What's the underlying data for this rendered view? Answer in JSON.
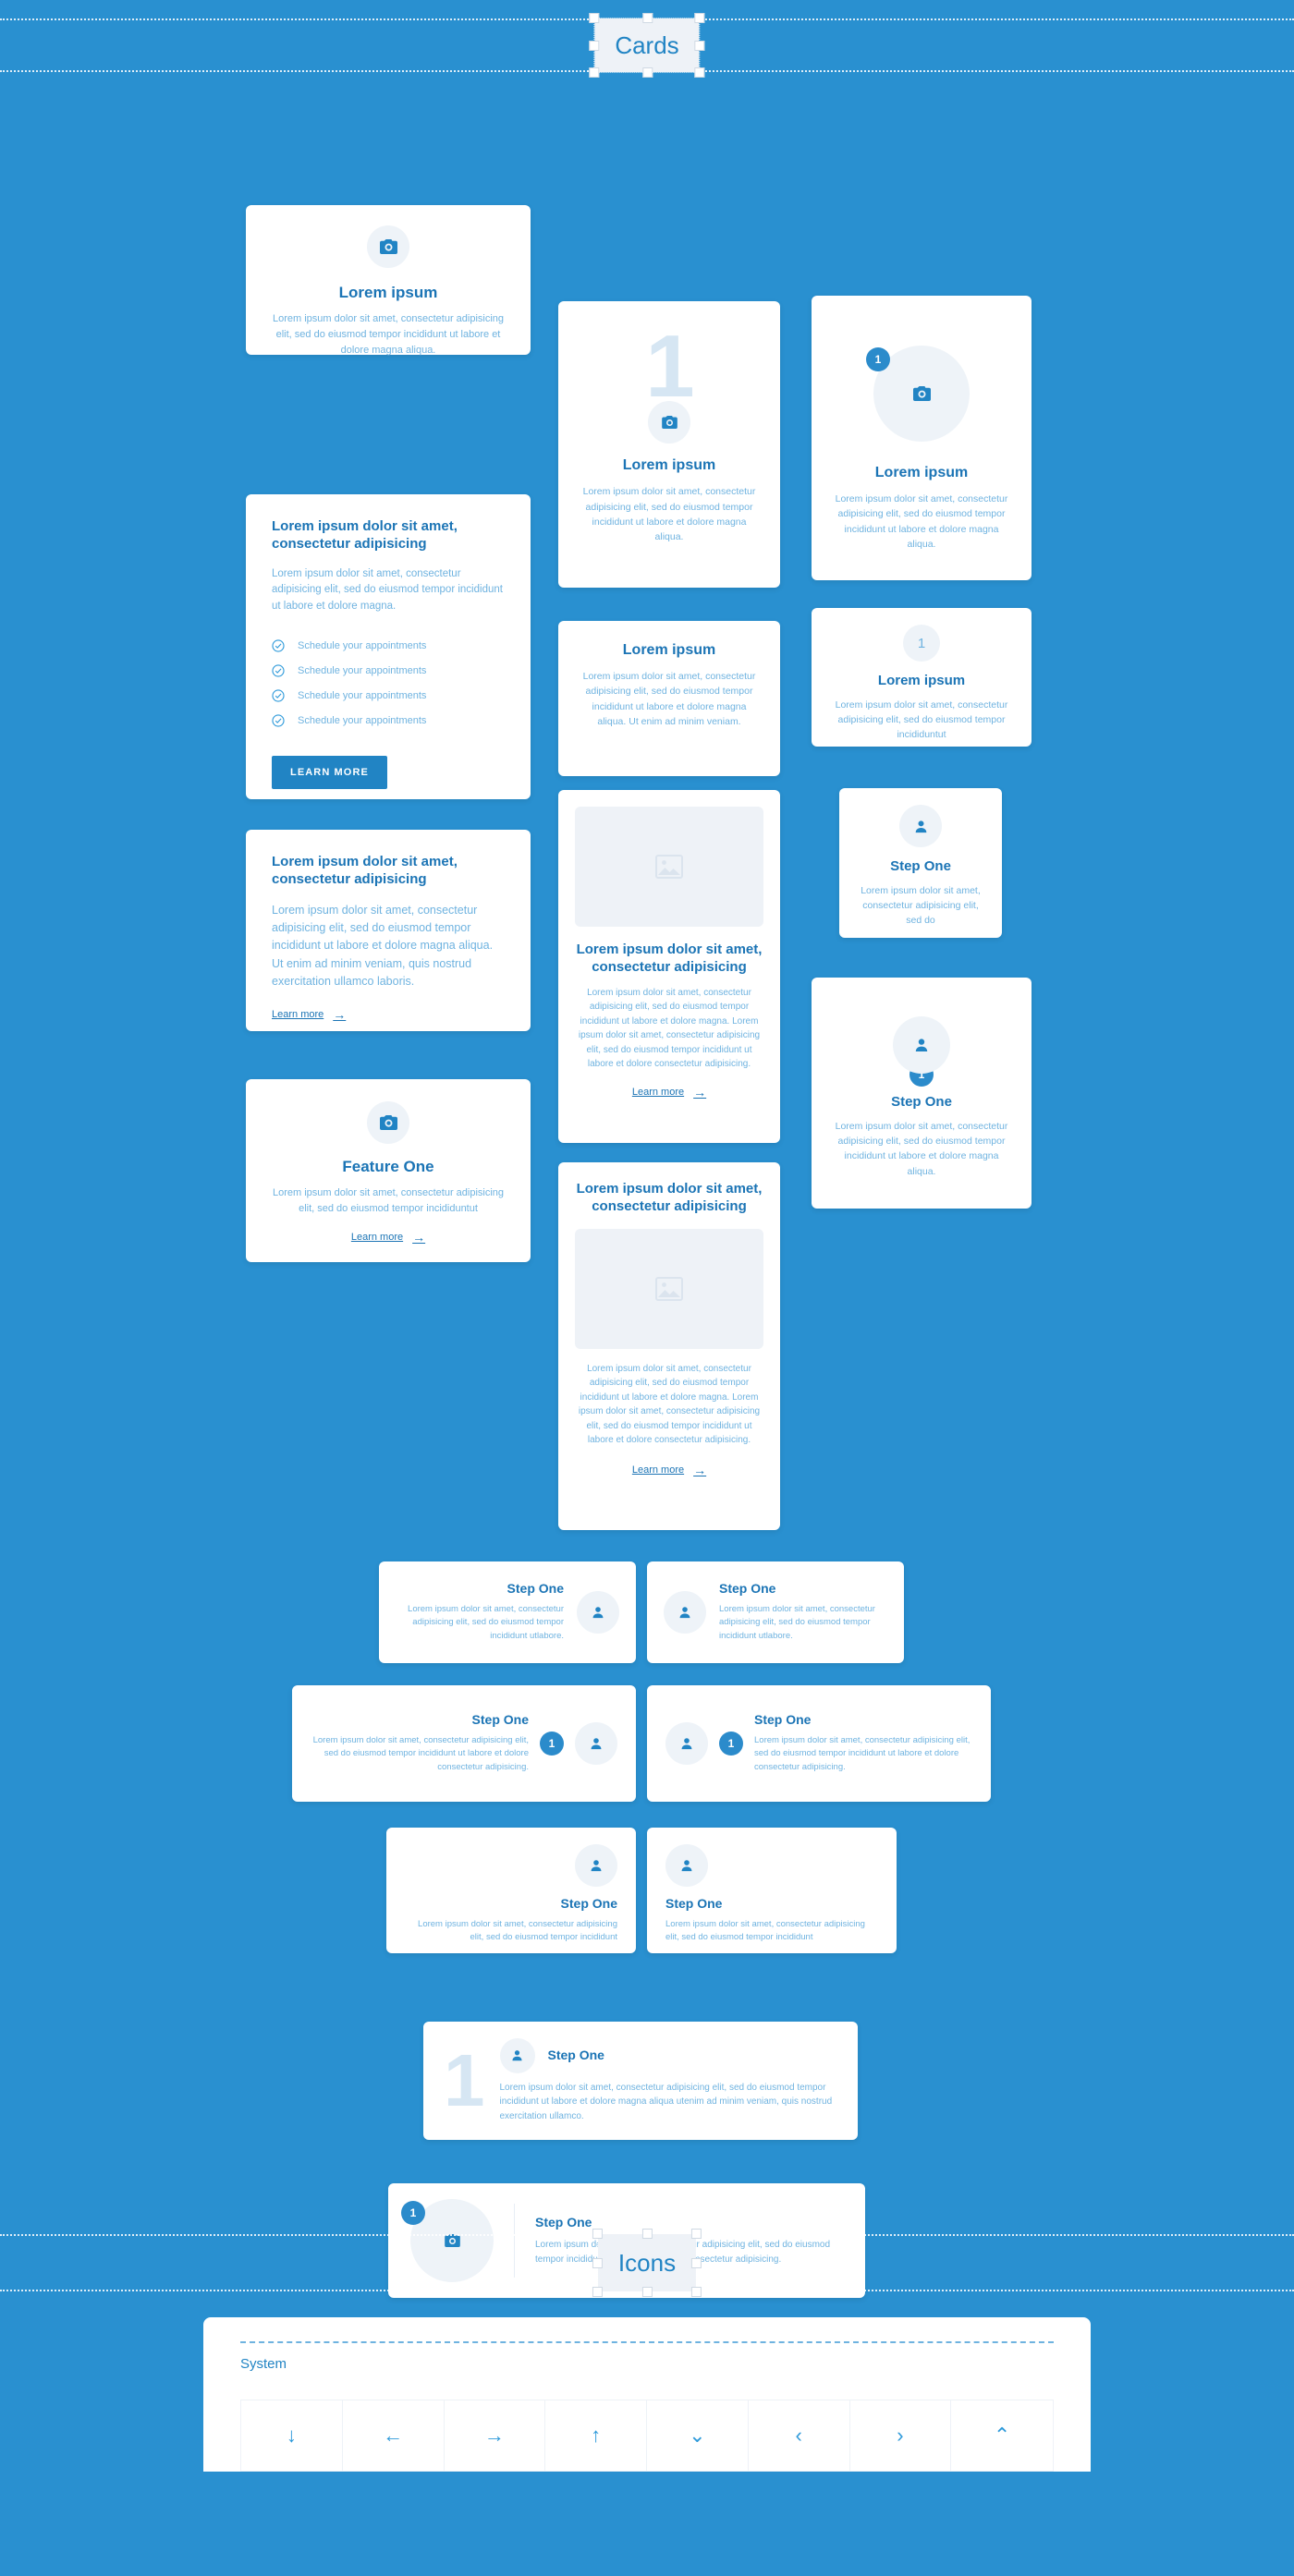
{
  "theme": {
    "background": "#2990d0",
    "card_bg": "#ffffff",
    "heading_color": "#1b74b5",
    "body_color": "#6fb3e0",
    "accent": "#2184c4",
    "icon_circle_bg": "#eef3f8",
    "ghost_number_color": "#d6e6f3"
  },
  "sections": {
    "cards_label": "Cards",
    "icons_label": "Icons"
  },
  "text": {
    "lorem_ipsum": "Lorem ipsum",
    "title_long": "Lorem ipsum dolor sit amet, consectetur adipisicing",
    "step_one": "Step One",
    "feature_one": "Feature One",
    "learn_more": "Learn more",
    "learn_more_btn": "LEARN MORE",
    "arrow": "→",
    "p_short": "Lorem ipsum dolor sit amet, consectetur adipisicing elit, sed do eiusmod tempor incididunt ut labore et dolore magna aliqua.",
    "p_magna": "Lorem ipsum dolor sit amet, consectetur adipisicing elit, sed do eiusmod tempor incididunt ut labore et dolore magna.",
    "p_veniam": "Lorem ipsum dolor sit amet, consectetur adipisicing elit, sed do eiusmod tempor incididunt ut labore et dolore magna aliqua. Ut enim ad minim veniam.",
    "p_incididuntut": "Lorem ipsum dolor sit amet, consectetur adipisicing elit, sed do eiusmod tempor incididuntut",
    "p_nostrud": "Lorem ipsum dolor sit amet, consectetur adipisicing elit, sed do eiusmod tempor incididunt ut labore et dolore magna aliqua. Ut enim ad minim veniam, quis nostrud exercitation ullamco laboris.",
    "p_double": "Lorem ipsum dolor sit amet, consectetur adipisicing elit, sed do eiusmod tempor incididunt ut labore et dolore magna. Lorem ipsum dolor sit amet, consectetur adipisicing elit, sed do eiusmod tempor incididunt ut labore et dolore consectetur adipisicing.",
    "p_sed_do": "Lorem ipsum dolor sit amet, consectetur adipisicing elit, sed do",
    "p_utlabore": "Lorem ipsum dolor sit amet, consectetur adipisicing elit, sed do eiusmod tempor incididunt utlabore.",
    "p_consectetur_adip": "Lorem ipsum dolor sit amet, consectetur adipisicing elit, sed do eiusmod tempor incididunt ut labore et dolore consectetur adipisicing.",
    "p_incididunt": "Lorem ipsum dolor sit amet, consectetur adipisicing elit, sed do eiusmod tempor incididunt",
    "p_ullamco": "Lorem ipsum dolor sit amet, consectetur adipisicing elit, sed do eiusmod tempor incididunt ut labore et dolore magna aliqua utenim ad minim veniam, quis nostrud exercitation ullamco.",
    "schedule": "Schedule your appointments",
    "num_one": "1"
  },
  "checklist": [
    "Schedule your appointments",
    "Schedule your appointments",
    "Schedule your appointments",
    "Schedule your appointments"
  ],
  "icons_panel": {
    "group_label": "System",
    "glyphs": [
      {
        "name": "arrow-down-icon",
        "glyph": "↓"
      },
      {
        "name": "arrow-left-icon",
        "glyph": "←"
      },
      {
        "name": "arrow-right-icon",
        "glyph": "→"
      },
      {
        "name": "arrow-up-icon",
        "glyph": "↑"
      },
      {
        "name": "chevron-down-icon",
        "glyph": "⌄"
      },
      {
        "name": "chevron-left-icon",
        "glyph": "‹"
      },
      {
        "name": "chevron-right-icon",
        "glyph": "›"
      },
      {
        "name": "chevron-up-icon",
        "glyph": "⌃"
      }
    ]
  }
}
